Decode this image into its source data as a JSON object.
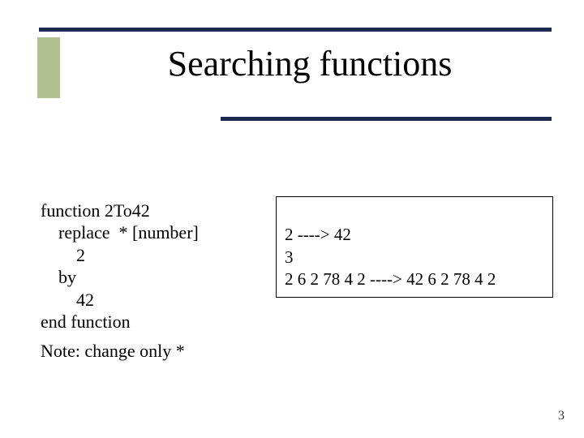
{
  "title": "Searching functions",
  "code": {
    "l1": "function 2To42",
    "l2": "    replace  * [number]",
    "l3": "        2",
    "l4": "    by",
    "l5": "        42",
    "l6": "end function"
  },
  "output": {
    "l1": "2 ----> 42",
    "l2": "3",
    "l3": "2 6 2 78 4 2 ----> 42 6 2 78 4 2"
  },
  "note": "Note: change only *",
  "page_number": "3"
}
